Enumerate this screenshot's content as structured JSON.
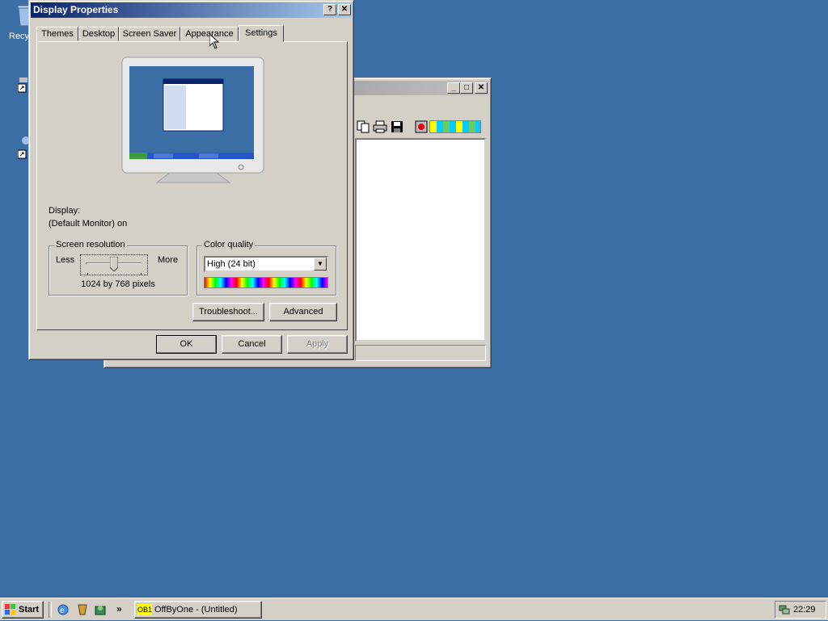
{
  "desktop": {
    "recycle_label": "Recy"
  },
  "dialog": {
    "title": "Display Properties",
    "help_glyph": "?",
    "close_glyph": "✕",
    "tabs": [
      {
        "label": "Themes"
      },
      {
        "label": "Desktop"
      },
      {
        "label": "Screen Saver"
      },
      {
        "label": "Appearance"
      },
      {
        "label": "Settings"
      }
    ],
    "display_label": "Display:",
    "display_value": "(Default Monitor) on",
    "resolution": {
      "legend": "Screen resolution",
      "less": "Less",
      "more": "More",
      "value_text": "1024 by 768 pixels",
      "slider_position": 0.5
    },
    "color_quality": {
      "legend": "Color quality",
      "selected": "High (24 bit)"
    },
    "troubleshoot_label": "Troubleshoot...",
    "advanced_label": "Advanced",
    "ok_label": "OK",
    "cancel_label": "Cancel",
    "apply_label": "Apply"
  },
  "bg_window": {
    "minimize_glyph": "_",
    "maximize_glyph": "□",
    "close_glyph": "✕"
  },
  "taskbar": {
    "start_label": "Start",
    "quicklaunch_more": "»",
    "task_badge": "OB1",
    "task_label": "OffByOne - (Untitled)",
    "clock": "22:29"
  },
  "colors": {
    "desktop": "#3a6ea5",
    "titlebar_active": "#0a246a",
    "face": "#d4d0c8"
  }
}
